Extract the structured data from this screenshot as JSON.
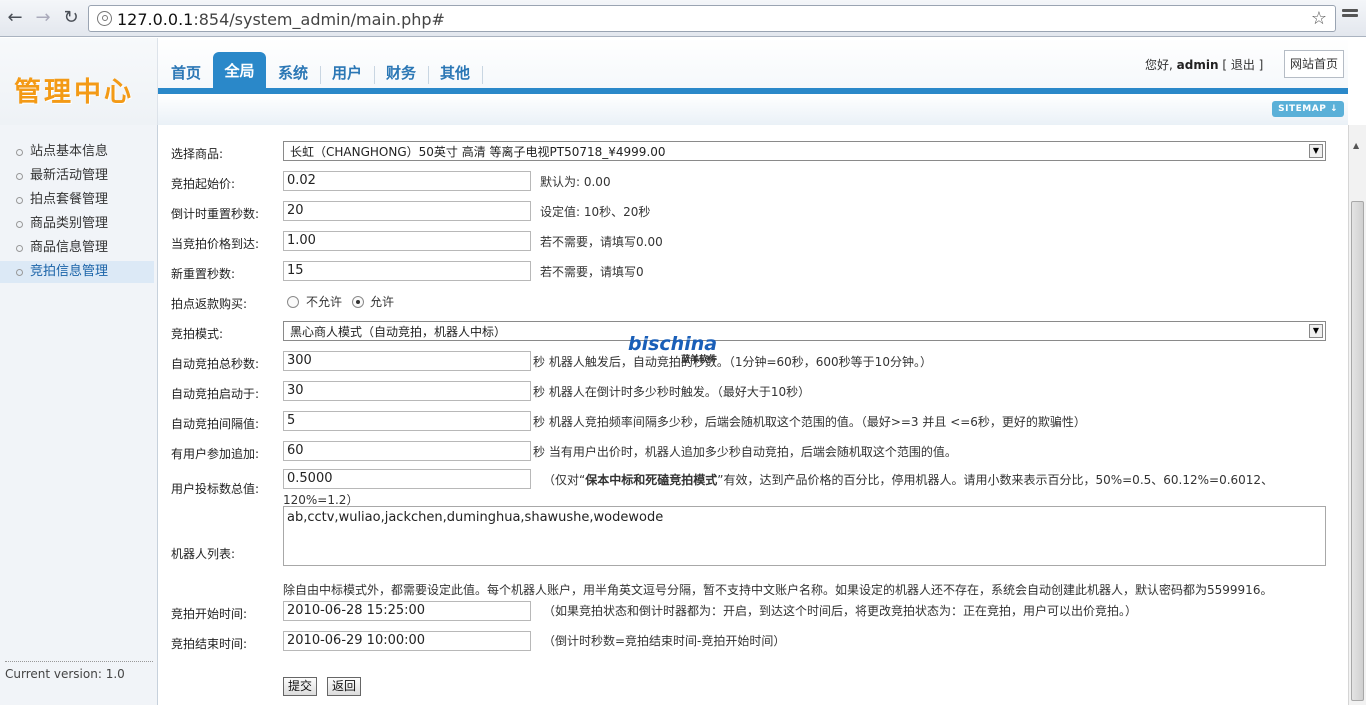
{
  "browser": {
    "url_host": "127.0.0.1",
    "url_path": ":854/system_admin/main.php#"
  },
  "header": {
    "logo_text": "管理中心",
    "tabs": [
      {
        "label": "首页"
      },
      {
        "label": "全局",
        "active": true
      },
      {
        "label": "系统"
      },
      {
        "label": "用户"
      },
      {
        "label": "财务"
      },
      {
        "label": "其他"
      }
    ],
    "greeting": "您好,",
    "username": "admin",
    "logout": "[ 退出 ]",
    "home_button": "网站首页",
    "sitemap": "SITEMAP"
  },
  "sidebar": {
    "items": [
      {
        "label": "站点基本信息"
      },
      {
        "label": "最新活动管理"
      },
      {
        "label": "拍点套餐管理"
      },
      {
        "label": "商品类别管理"
      },
      {
        "label": "商品信息管理"
      },
      {
        "label": "竞拍信息管理",
        "active": true
      }
    ],
    "version": "Current version: 1.0"
  },
  "form": {
    "product": {
      "label": "选择商品:",
      "value": "长虹（CHANGHONG）50英寸 高清 等离子电视PT50718_¥4999.00"
    },
    "start_price": {
      "label": "竞拍起始价:",
      "value": "0.02",
      "hint": "默认为: 0.00"
    },
    "reset_seconds": {
      "label": "倒计时重置秒数:",
      "value": "20",
      "hint": "设定值: 10秒、20秒"
    },
    "price_reached": {
      "label": "当竞拍价格到达:",
      "value": "1.00",
      "hint": "若不需要，请填写0.00"
    },
    "new_reset": {
      "label": "新重置秒数:",
      "value": "15",
      "hint": "若不需要，请填写0"
    },
    "refund": {
      "label": "拍点返款购买:",
      "option_no": "不允许",
      "option_yes": "允许"
    },
    "mode": {
      "label": "竞拍模式:",
      "value": "黑心商人模式（自动竞拍，机器人中标）"
    },
    "auto_total": {
      "label": "自动竞拍总秒数:",
      "value": "300",
      "hint": "秒  机器人触发后，自动竞拍的秒数。（1分钟=60秒，600秒等于10分钟。）"
    },
    "auto_start": {
      "label": "自动竞拍启动于:",
      "value": "30",
      "hint": "秒  机器人在倒计时多少秒时触发。（最好大于10秒）"
    },
    "auto_interval": {
      "label": "自动竞拍间隔值:",
      "value": "5",
      "hint": "秒  机器人竞拍频率间隔多少秒，后端会随机取这个范围的值。（最好>=3 并且 <=6秒，更好的欺骗性）"
    },
    "user_add": {
      "label": "有用户参加追加:",
      "value": "60",
      "hint": "秒  当有用户出价时，机器人追加多少秒自动竞拍，后端会随机取这个范围的值。"
    },
    "bid_total": {
      "label": "用户投标数总值:",
      "value": "0.5000",
      "hint_pre": "（仅对“",
      "hint_bold": "保本中标和死磕竞拍模式",
      "hint_post": "”有效，达到产品价格的百分比，停用机器人。请用小数来表示百分比，50%=0.5、60.12%=0.6012、",
      "hint_line2": "120%=1.2）"
    },
    "robots": {
      "label": "机器人列表:",
      "value": "ab,cctv,wuliao,jackchen,duminghua,shawushe,wodewode",
      "hint": "除自由中标模式外，都需要设定此值。每个机器人账户，用半角英文逗号分隔，暂不支持中文账户名称。如果设定的机器人还不存在，系统会自动创建此机器人，默认密码都为5599916。"
    },
    "start_time": {
      "label": "竞拍开始时间:",
      "value": "2010-06-28 15:25:00",
      "hint": "（如果竞拍状态和倒计时器都为：开启，到达这个时间后，将更改竞拍状态为：正在竞拍，用户可以出价竞拍。）"
    },
    "end_time": {
      "label": "竞拍结束时间:",
      "value": "2010-06-29 10:00:00",
      "hint": "（倒计时秒数=竞拍结束时间-竞拍开始时间）"
    },
    "submit": "提交",
    "back": "返回"
  },
  "watermark": {
    "main": "bischina",
    "sub": "蓝羊软件"
  }
}
